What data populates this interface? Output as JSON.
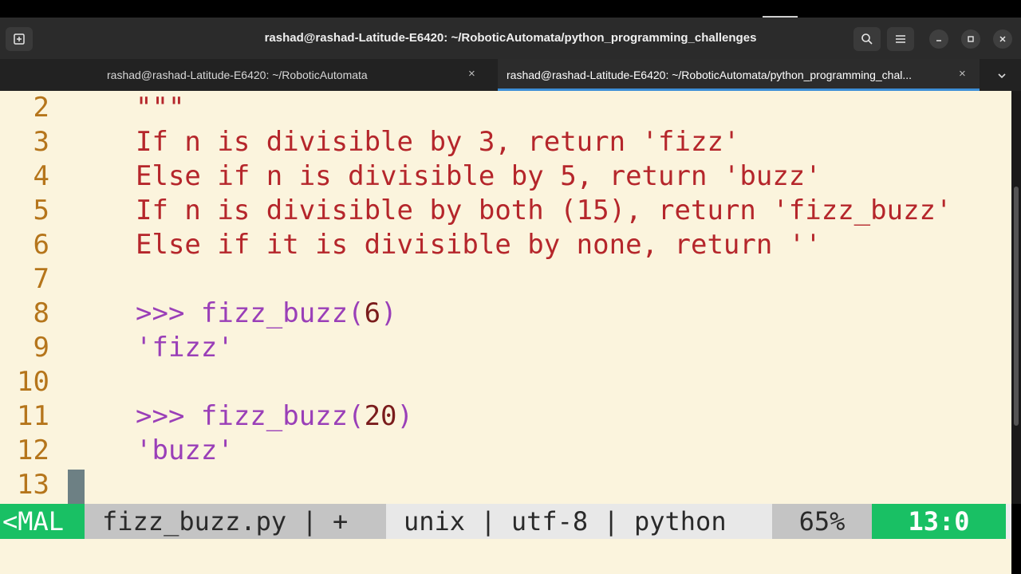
{
  "window": {
    "title": "rashad@rashad-Latitude-E6420: ~/RoboticAutomata/python_programming_challenges",
    "new_tab_icon": "new-tab-icon",
    "search_icon": "search-icon",
    "menu_icon": "hamburger-icon",
    "minimize_icon": "minimize-icon",
    "maximize_icon": "maximize-icon",
    "close_icon": "close-icon"
  },
  "tabs": [
    {
      "label": "rashad@rashad-Latitude-E6420: ~/RoboticAutomata",
      "active": false
    },
    {
      "label": "rashad@rashad-Latitude-E6420: ~/RoboticAutomata/python_programming_chal...",
      "active": true
    }
  ],
  "editor": {
    "lines": [
      {
        "n": "2",
        "text": "\"\"\""
      },
      {
        "n": "3",
        "text": "If n is divisible by 3, return 'fizz'"
      },
      {
        "n": "4",
        "text": "Else if n is divisible by 5, return 'buzz'"
      },
      {
        "n": "5",
        "text": "If n is divisible by both (15), return 'fizz_buzz'"
      },
      {
        "n": "6",
        "text": "Else if it is divisible by none, return ''"
      },
      {
        "n": "7",
        "text": ""
      },
      {
        "n": "8",
        "prompt": ">>> fizz_buzz(",
        "arg": "6",
        "close": ")"
      },
      {
        "n": "9",
        "text": "'fizz'"
      },
      {
        "n": "10",
        "text": ""
      },
      {
        "n": "11",
        "prompt": ">>> fizz_buzz(",
        "arg": "20",
        "close": ")"
      },
      {
        "n": "12",
        "text": "'buzz'"
      },
      {
        "n": "13",
        "text": ""
      }
    ]
  },
  "statusline": {
    "mode": "<MAL",
    "file": "fizz_buzz.py | +",
    "info": "unix | utf-8 | python",
    "percent": "65%",
    "position": "13:0"
  },
  "colors": {
    "string": "#b5262b",
    "doctest": "#9a3fb8",
    "line_number": "#b5751b",
    "mode_bg": "#19c064",
    "editor_bg": "#fbf4dd"
  }
}
